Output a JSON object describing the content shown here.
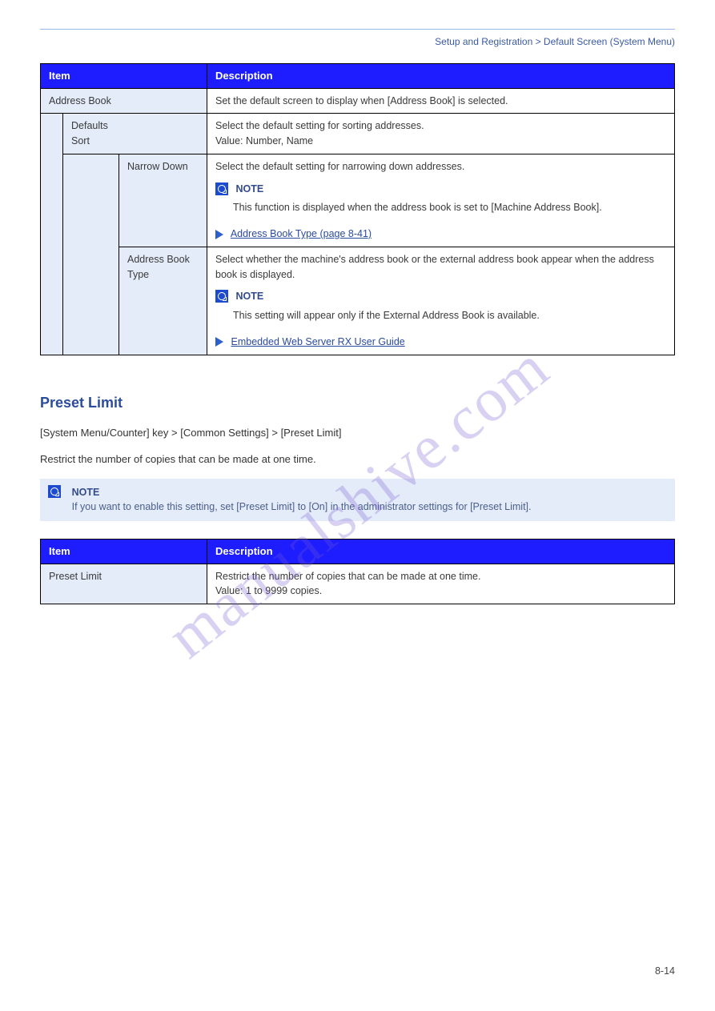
{
  "header": {
    "breadcrumb": "Setup and Registration > Default Screen (System Menu)"
  },
  "table1": {
    "col1": "Item",
    "col2": "Description",
    "rows": {
      "r0": {
        "item": "Address Book",
        "desc": "Set the default screen to display when [Address Book] is selected."
      },
      "subgroup": "Defaults",
      "r1": {
        "item": "Sort",
        "desc_l1": "Select the default setting for sorting addresses.",
        "desc_l2": "Value: Number, Name"
      },
      "r2": {
        "item": "Narrow Down",
        "desc_l1": "Select the default setting for narrowing down addresses.",
        "note_label": "NOTE",
        "note_body": "This function is displayed when the address book is set to [Machine Address Book].",
        "ref": "Address Book Type (page 8-41)"
      },
      "r3": {
        "item": "Address Book Type",
        "desc_l1": "Select whether the machine's address book or the external address book appear when the address book is displayed.",
        "note_label": "NOTE",
        "note_body": "This setting will appear only if the External Address Book is available.",
        "ref": "Embedded Web Server RX User Guide"
      }
    }
  },
  "section2": {
    "heading": "Preset Limit",
    "nav": "[System Menu/Counter] key > [Common Settings] > [Preset Limit]",
    "para": "Restrict the number of copies that can be made at one time.",
    "note_label": "NOTE",
    "note_body": "If you want to enable this setting, set [Preset Limit] to [On] in the administrator settings for [Preset Limit]."
  },
  "table2": {
    "col1": "Item",
    "col2": "Description",
    "r1": {
      "item": "Preset Limit",
      "desc_l1": "Restrict the number of copies that can be made at one time.",
      "desc_l2": "Value: 1 to 9999 copies."
    }
  },
  "page_number": "8-14",
  "watermark": "manualshive.com"
}
